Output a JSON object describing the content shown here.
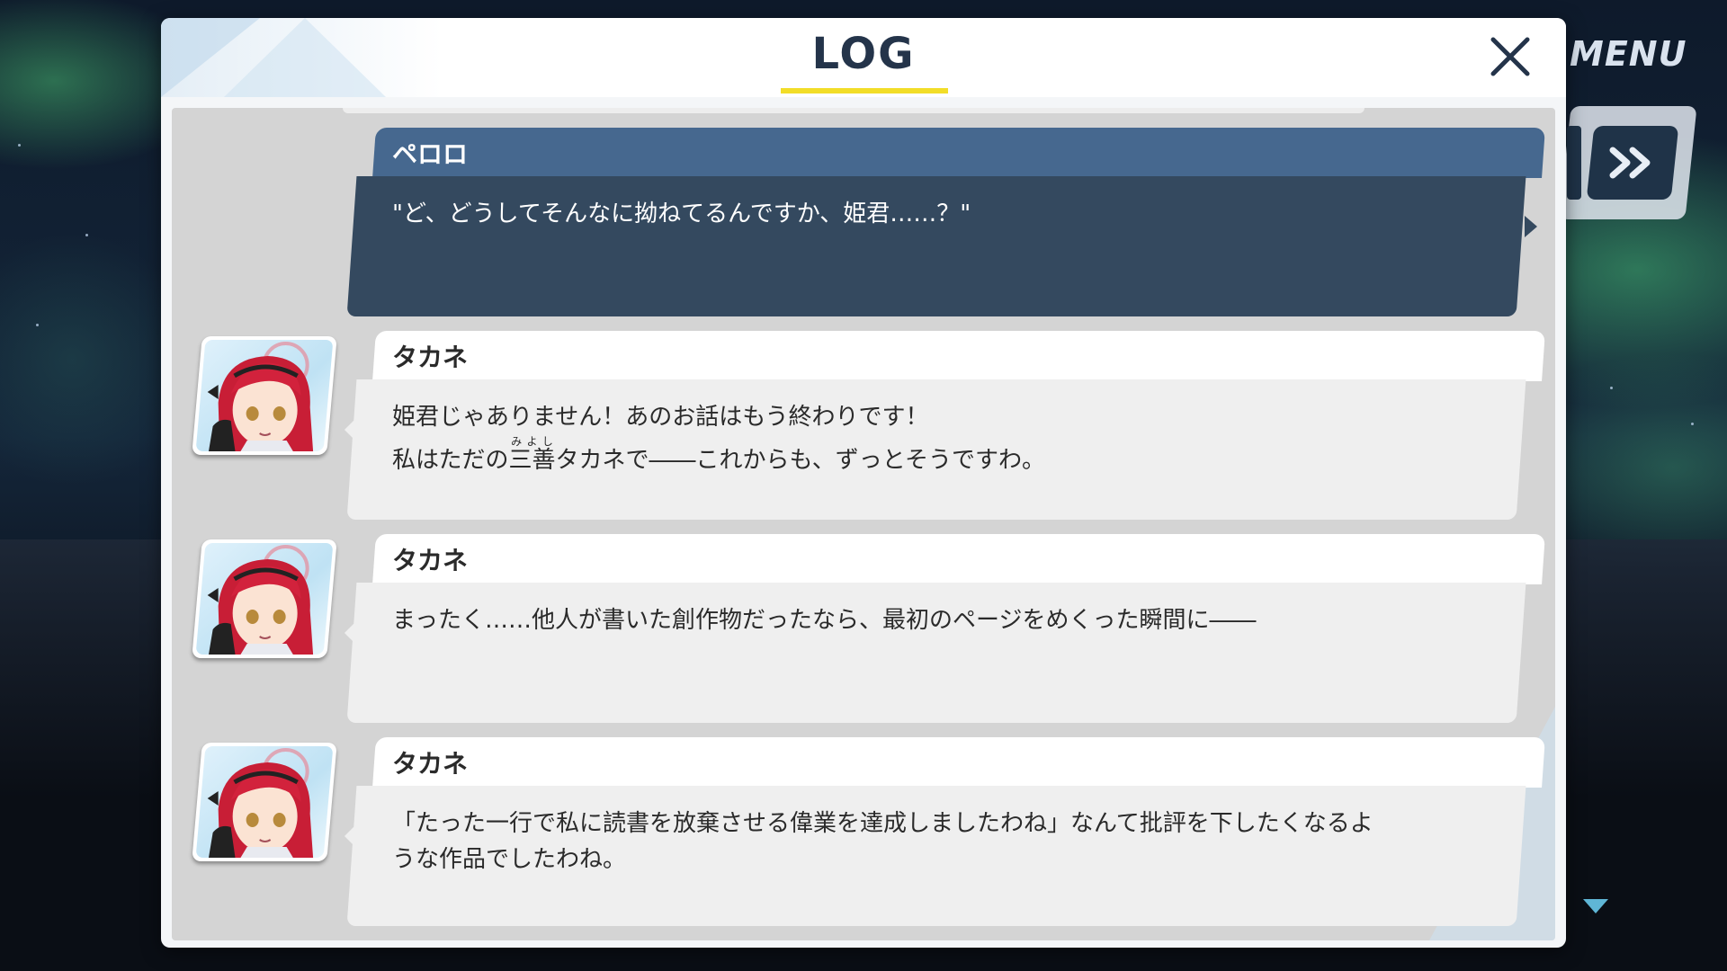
{
  "window": {
    "title": "LOG",
    "close_icon": "close-x-icon"
  },
  "hud": {
    "menu_label": "MENU",
    "skip_icon": "fast-forward-icon",
    "scroll_icon": "triangle-down-icon"
  },
  "log": {
    "entries": [
      {
        "speaker": "ペロロ",
        "kind": "player",
        "line1": "\"ど、どうしてそんなに拗ねてるんですか、姫君……？\""
      },
      {
        "speaker": "タカネ",
        "kind": "npc",
        "line1": "姫君じゃありません！あのお話はもう終わりです！",
        "line2_before": "私はただの",
        "ruby_base": "三善",
        "ruby_text": "みよし",
        "line2_after": "タカネで――これからも、ずっとそうですわ。"
      },
      {
        "speaker": "タカネ",
        "kind": "npc",
        "line1": "まったく……他人が書いた創作物だったなら、最初のページをめくった瞬間に――"
      },
      {
        "speaker": "タカネ",
        "kind": "npc",
        "line1": "「たった一行で私に読書を放棄させる偉業を達成しましたわね」なんて批評を下したくなるよ",
        "line2": "うな作品でしたわね。"
      }
    ]
  },
  "colors": {
    "title_underline": "#f2dd28",
    "player_name_bar": "#46688f",
    "player_text_box": "#34495f",
    "npc_name_bar": "#ffffff",
    "npc_text_box": "#efefef",
    "scroll_arrow": "#5fb6d6"
  }
}
